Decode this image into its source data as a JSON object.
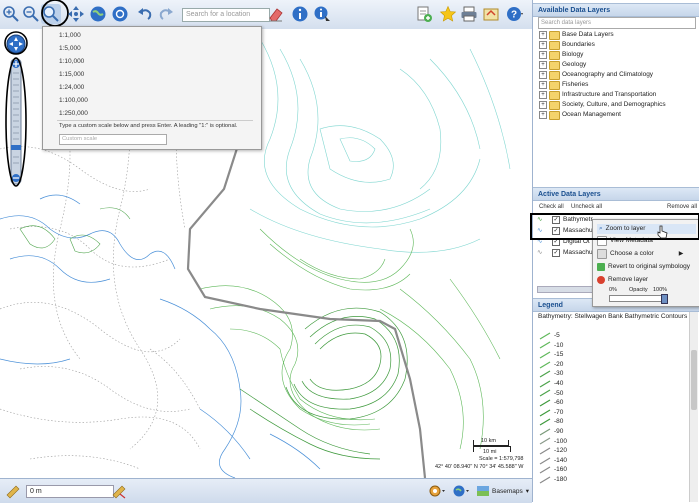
{
  "toolbar": {
    "search_placeholder": "Search for a location",
    "basemaps_label": "Basemaps"
  },
  "scale_menu": {
    "options": [
      "1:1,000",
      "1:5,000",
      "1:10,000",
      "1:15,000",
      "1:24,000",
      "1:100,000",
      "1:250,000"
    ],
    "hint": "Type a custom scale below and press Enter. A leading \"1:\" is optional.",
    "custom_placeholder": "Custom scale"
  },
  "available_layers": {
    "title": "Available Data Layers",
    "search_placeholder": "Search data layers",
    "folders": [
      "Base Data Layers",
      "Boundaries",
      "Biology",
      "Geology",
      "Oceanography and Climatology",
      "Fisheries",
      "Infrastructure and Transportation",
      "Society, Culture, and Demographics",
      "Ocean Management"
    ]
  },
  "active_layers": {
    "title": "Active Data Layers",
    "check_all": "Check all",
    "uncheck_all": "Uncheck all",
    "remove_all": "Remove all",
    "layers": [
      "Bathymetr",
      "Massachu",
      "Digital Ot",
      "Massachu"
    ]
  },
  "context_menu": {
    "items": [
      "Zoom to layer",
      "View Metadata",
      "Choose a color",
      "Revert to original symbology",
      "Remove layer"
    ],
    "opacity_label": "Opacity",
    "opacity_min": "0%",
    "opacity_max": "100%"
  },
  "legend": {
    "title": "Legend",
    "layer_name": "Bathymetry: Stellwagen Bank Bathymetric Contours",
    "contours": [
      "-5",
      "-10",
      "-15",
      "-20",
      "-30",
      "-40",
      "-50",
      "-60",
      "-70",
      "-80",
      "-90",
      "-100",
      "-120",
      "-140",
      "-160",
      "-180"
    ]
  },
  "map": {
    "scalebar_km": "10 km",
    "scalebar_mi": "10 mi",
    "scale_text": "Scale = 1:579,798",
    "coords": "42° 40' 08.940\" N 70° 34' 45.588\" W"
  },
  "bottom": {
    "measure_value": "0 m"
  },
  "colors": {
    "contour_light": "#7fd6d0",
    "contour_green": "#5fb85a",
    "coast_blue": "#4a90d8",
    "boundary_gray": "#8a8a8a",
    "header_blue": "#1a4f8f"
  }
}
